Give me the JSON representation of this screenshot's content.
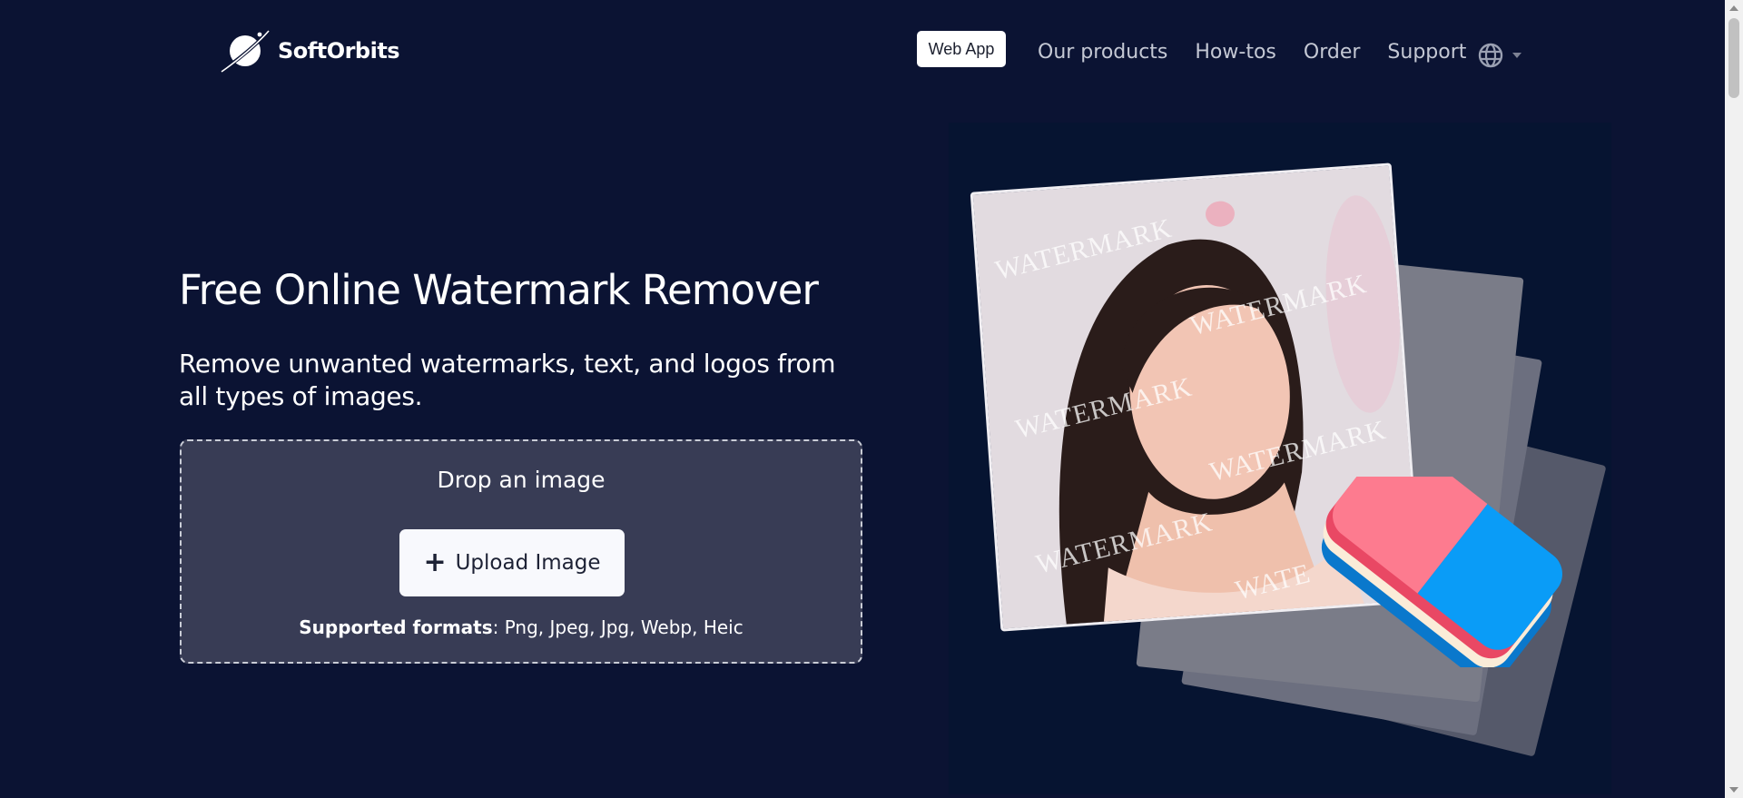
{
  "header": {
    "brand": "SoftOrbits",
    "web_app_label": "Web App",
    "nav": [
      {
        "label": "Our products"
      },
      {
        "label": "How-tos"
      },
      {
        "label": "Order"
      },
      {
        "label": "Support"
      }
    ],
    "language_icon": "globe-icon"
  },
  "hero": {
    "title": "Free Online Watermark Remover",
    "subtitle": "Remove unwanted watermarks, text, and logos from all types of images."
  },
  "dropzone": {
    "drop_label": "Drop an image",
    "upload_label": "Upload Image",
    "formats_label": "Supported formats",
    "formats_value": ": Png, Jpeg, Jpg, Webp, Heic"
  },
  "illustration": {
    "watermark_text": "WATERMARK",
    "watermark_partial": "WATE"
  },
  "colors": {
    "background": "#0b1333",
    "dropzone": "#383c55",
    "eraser_pink": "#fd7b8f",
    "eraser_blue": "#0a9cf7"
  }
}
